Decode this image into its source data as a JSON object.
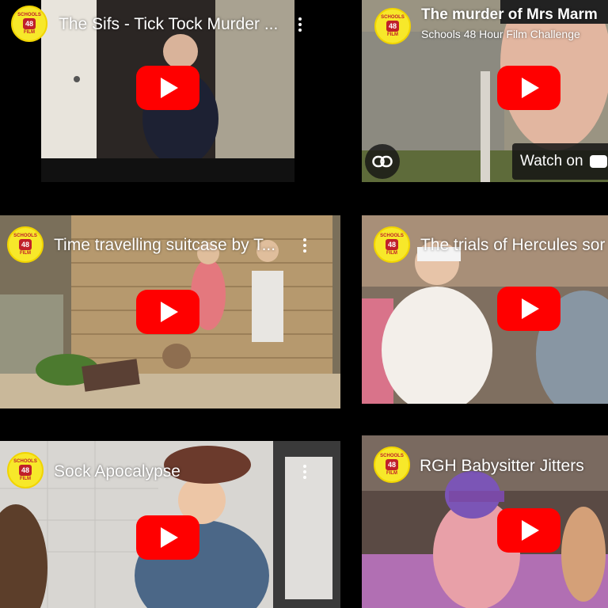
{
  "channel": {
    "badge_top": "SCHOOLS",
    "badge_num": "48",
    "badge_bottom": "FILM"
  },
  "videos": [
    {
      "title": "The Sifs - Tick Tock Murder ..."
    },
    {
      "title": "The murder of Mrs Marm",
      "subtitle": "Schools 48 Hour Film Challenge",
      "watch_label": "Watch on"
    },
    {
      "title": "Time travelling suitcase by T..."
    },
    {
      "title": "The trials of Hercules sor"
    },
    {
      "title": "Sock Apocalypse"
    },
    {
      "title": "RGH Babysitter Jitters"
    }
  ],
  "icons": {
    "play": "youtube-play-icon",
    "menu": "more-vert-icon",
    "link": "link-icon"
  },
  "colors": {
    "play_button": "#ff0000",
    "channel_badge": "#f7e82a",
    "badge_text": "#c0202a"
  }
}
